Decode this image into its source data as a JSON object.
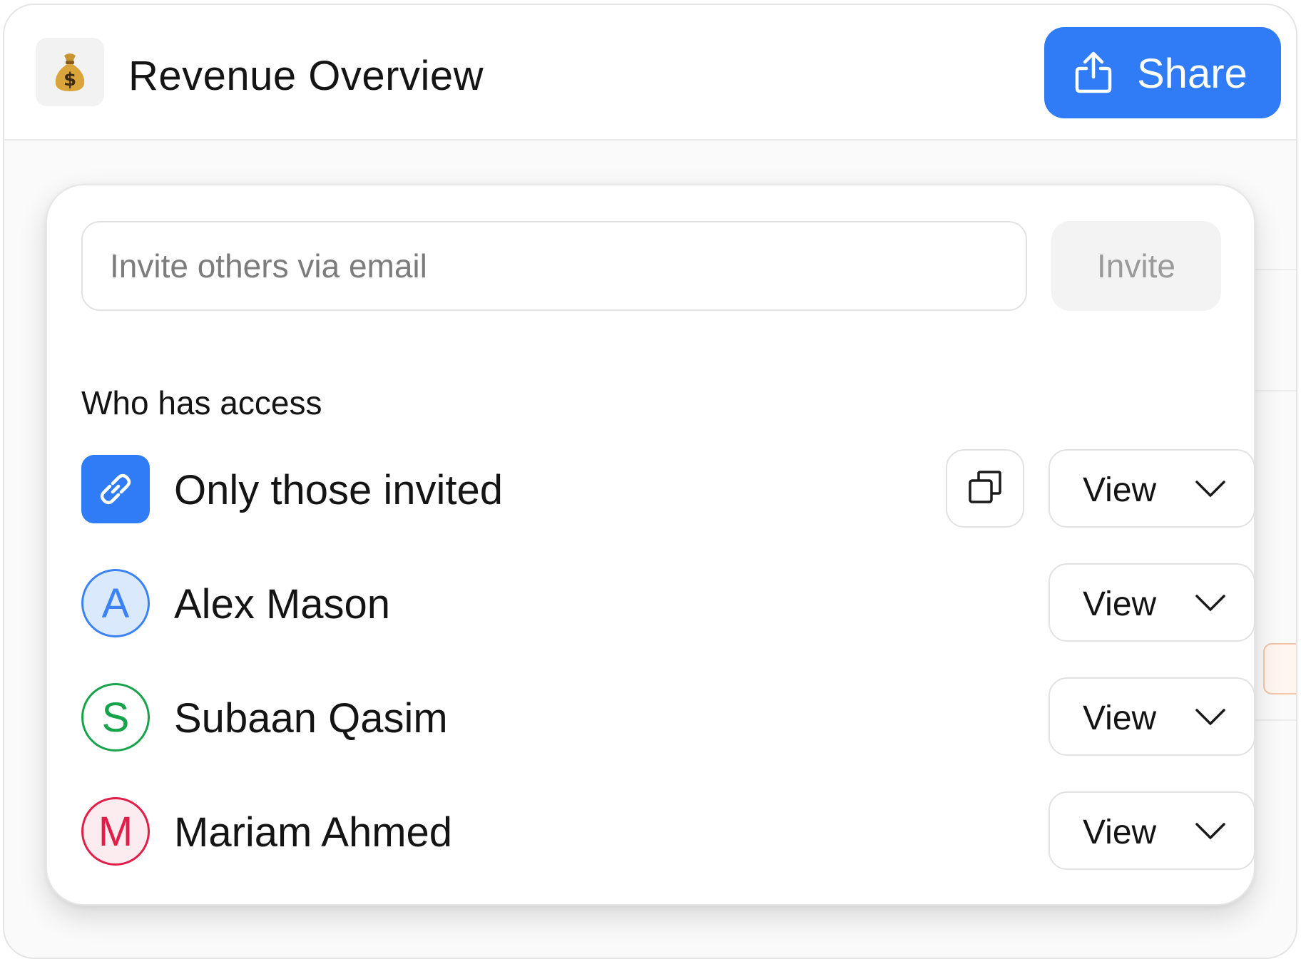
{
  "header": {
    "app_icon": "money-bag-icon",
    "title": "Revenue Overview",
    "share_label": "Share",
    "share_icon": "share-upload-icon"
  },
  "share_dialog": {
    "email_placeholder": "Invite others via email",
    "invite_label": "Invite",
    "section_title": "Who has access",
    "link_access": {
      "label": "Only those invited",
      "icon": "link-icon",
      "copy_icon": "copy-icon",
      "permission": "View"
    },
    "people": [
      {
        "initial": "A",
        "name": "Alex Mason",
        "permission": "View",
        "color": "#3b82f6",
        "bg": "#dbe9fd"
      },
      {
        "initial": "S",
        "name": "Subaan Qasim",
        "permission": "View",
        "color": "#16a34a",
        "bg": "#ffffff"
      },
      {
        "initial": "M",
        "name": "Mariam Ahmed",
        "permission": "View",
        "color": "#e11d48",
        "bg": "#fdecef"
      }
    ]
  },
  "colors": {
    "accent": "#2f7cf6"
  }
}
